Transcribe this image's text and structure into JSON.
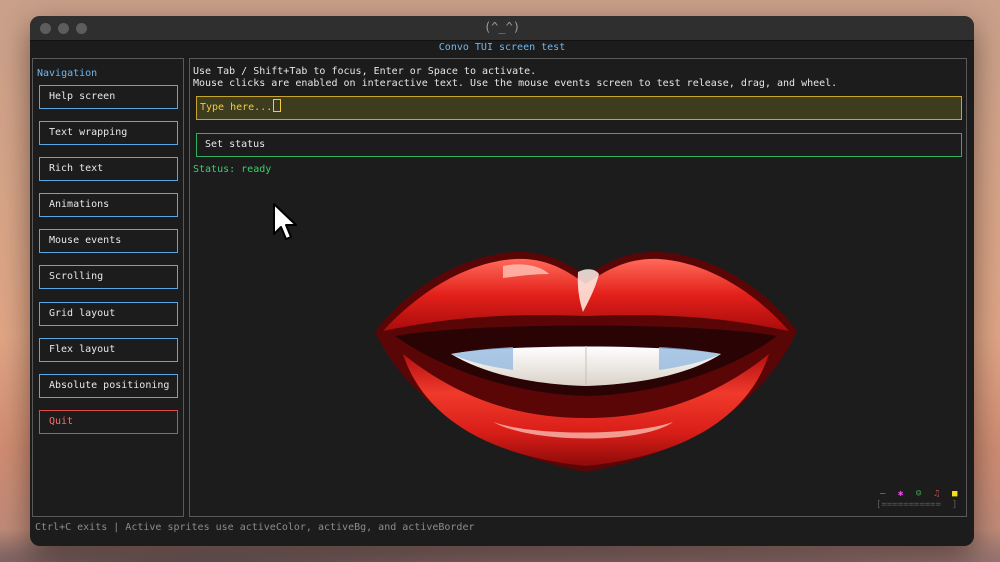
{
  "window": {
    "title": "(^_^)"
  },
  "app": {
    "header": "Convo TUI screen test"
  },
  "navigation": {
    "title": "Navigation",
    "items": [
      {
        "label": "Help screen"
      },
      {
        "label": "Text wrapping"
      },
      {
        "label": "Rich text"
      },
      {
        "label": "Animations"
      },
      {
        "label": "Mouse events"
      },
      {
        "label": "Scrolling"
      },
      {
        "label": "Grid layout"
      },
      {
        "label": "Flex layout"
      },
      {
        "label": "Absolute positioning"
      },
      {
        "label": "Quit"
      }
    ]
  },
  "main": {
    "help_line_1": "Use Tab / Shift+Tab to focus, Enter or Space to activate.",
    "help_line_2": "Mouse clicks are enabled on interactive text. Use the mouse events screen to test release, drag, and wheel.",
    "input": {
      "placeholder": "Type here..."
    },
    "set_status_label": "Set status",
    "status_text": "Status: ready",
    "mini_sprites_bar": "[===========  ]"
  },
  "footer": {
    "text": "Ctrl+C exits | Active sprites use activeColor, activeBg, and activeBorder"
  },
  "colors": {
    "accent_blue": "#5aa7e6",
    "focus_yellow": "#c9a42a",
    "status_green": "#39d06a",
    "quit_red": "#e04848",
    "lips_red": "#e0211c"
  },
  "icons": [
    "lips-sprite",
    "mouse-pointer-icon"
  ]
}
